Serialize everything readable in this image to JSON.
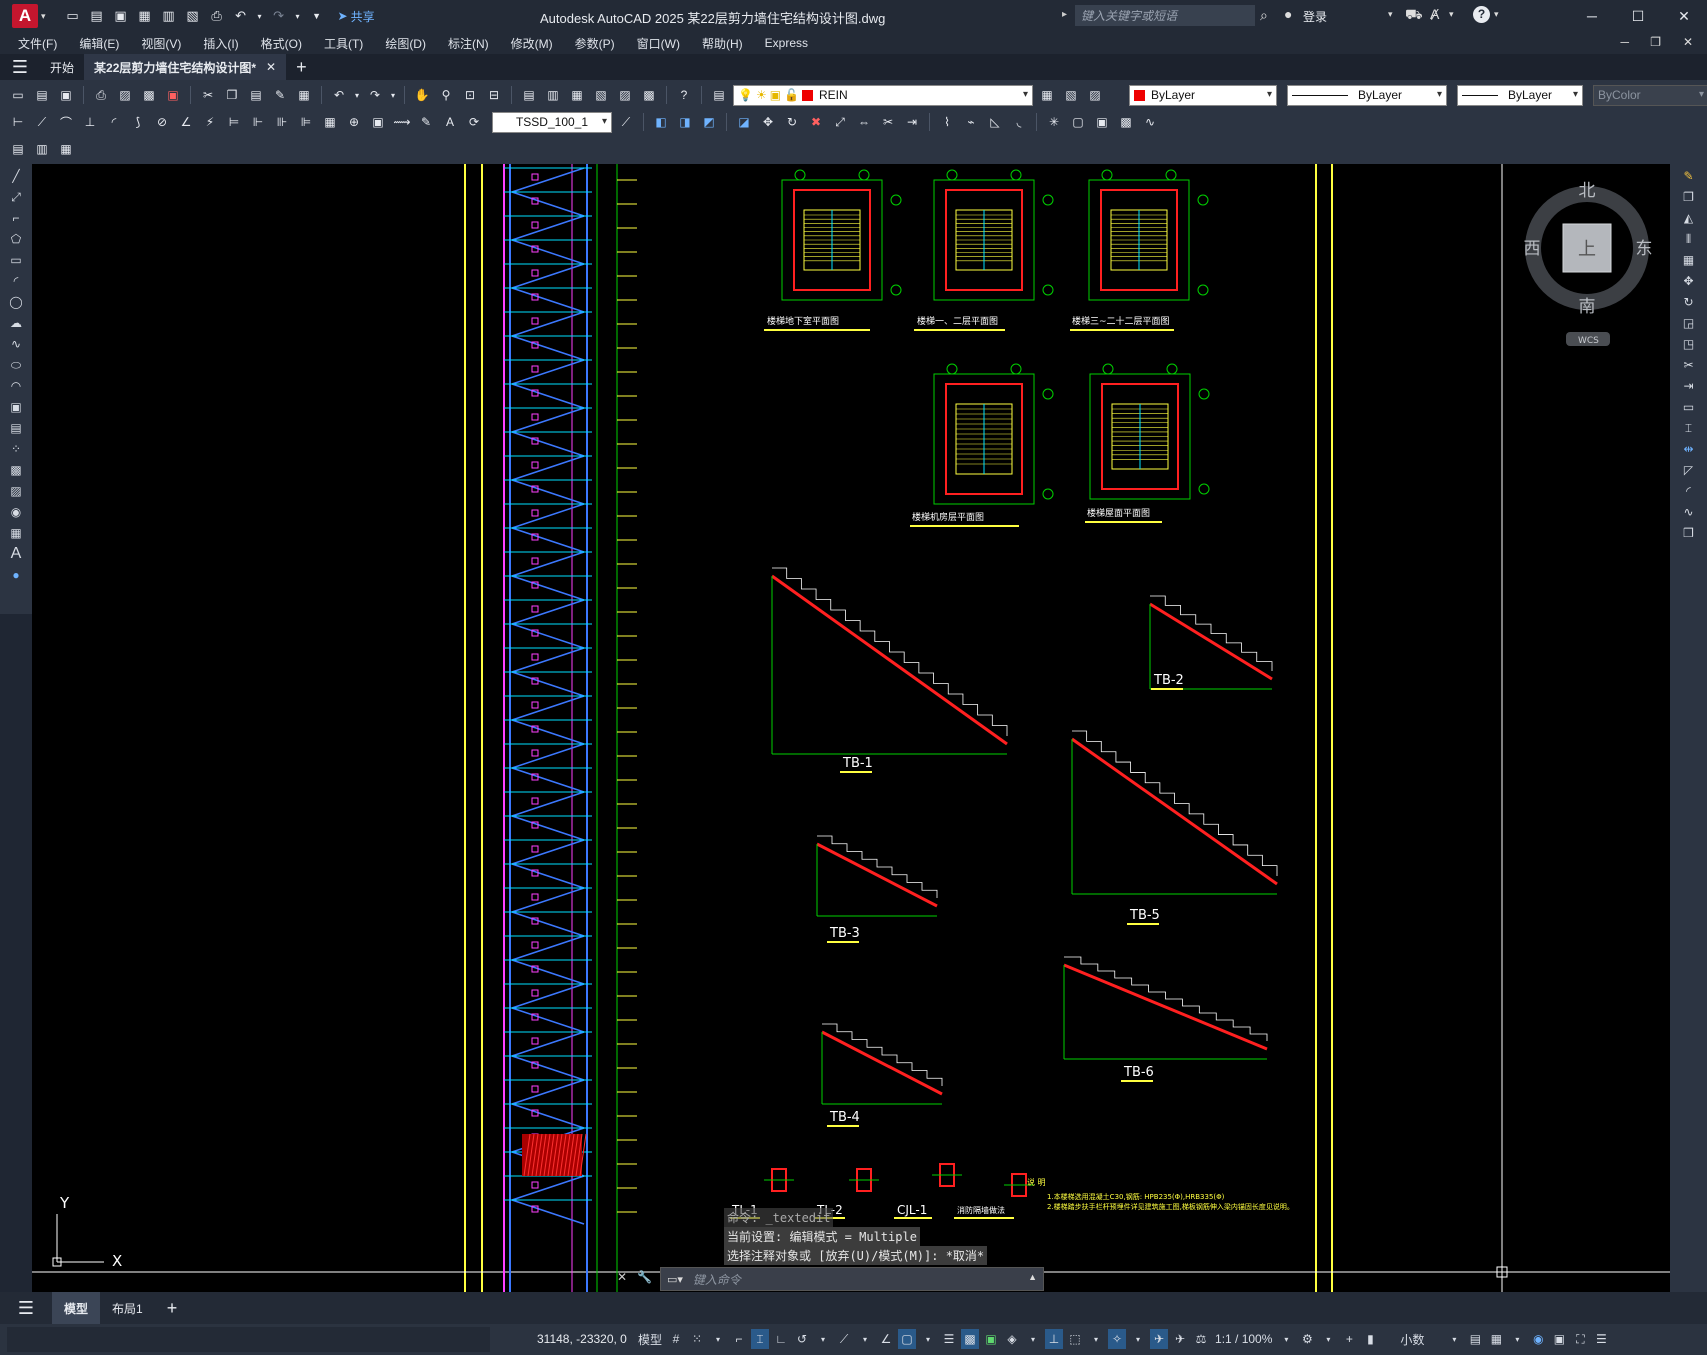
{
  "titlebar": {
    "logo": "A",
    "share_label": "共享",
    "title": "Autodesk AutoCAD 2025    某22层剪力墙住宅结构设计图.dwg",
    "search_placeholder": "键入关键字或短语",
    "login_label": "登录"
  },
  "menu": [
    "文件(F)",
    "编辑(E)",
    "视图(V)",
    "插入(I)",
    "格式(O)",
    "工具(T)",
    "绘图(D)",
    "标注(N)",
    "修改(M)",
    "参数(P)",
    "窗口(W)",
    "帮助(H)",
    "Express"
  ],
  "tabs": {
    "start": "开始",
    "document": "某22层剪力墙住宅结构设计图*"
  },
  "layer": {
    "current": "REIN",
    "color": "ByLayer",
    "linetype": "ByLayer",
    "lineweight": "ByLayer",
    "plotstyle": "ByColor",
    "dimstyle": "TSSD_100_1"
  },
  "viewcube": {
    "north": "北",
    "south": "南",
    "east": "东",
    "west": "西",
    "face": "上",
    "wcs": "WCS"
  },
  "ucs": {
    "x": "X",
    "y": "Y"
  },
  "drawing_labels": {
    "plan_titles": [
      "楼梯地下室平面图",
      "楼梯一、二层平面图",
      "楼梯三~二十二层平面图",
      "楼梯机房层平面图",
      "楼梯屋面平面图"
    ],
    "stairs": [
      "TB-1",
      "TB-2",
      "TB-3",
      "TB-4",
      "TB-5",
      "TB-6"
    ],
    "beams": [
      "TL-1",
      "TL-2",
      "CJL-1",
      "消防隔墙做法"
    ],
    "note_title": "说 明",
    "notes": [
      "1.本楼梯选用混凝土C30,钢筋: HPB235(Φ),HRB335(Φ)",
      "2.楼梯踏步扶手栏杆预埋件详见建筑施工图,梯板钢筋伸入梁内锚固长度见说明。"
    ]
  },
  "command": {
    "history": [
      "命令: _textedit",
      "当前设置: 编辑模式 = Multiple",
      "选择注释对象或 [放弃(U)/模式(M)]: *取消*"
    ],
    "placeholder": "键入命令"
  },
  "layout_tabs": [
    "模型",
    "布局1"
  ],
  "status": {
    "coords": "31148, -23320, 0",
    "space": "模型",
    "scale": "1:1 / 100%",
    "units": "小数"
  },
  "colors": {
    "stair_green": "#00d000",
    "rebar_red": "#ff2020",
    "frame_yellow": "#ffff40",
    "stair_blue": "#3c78ff",
    "magenta": "#ff40ff",
    "cyan": "#00e0ff"
  }
}
